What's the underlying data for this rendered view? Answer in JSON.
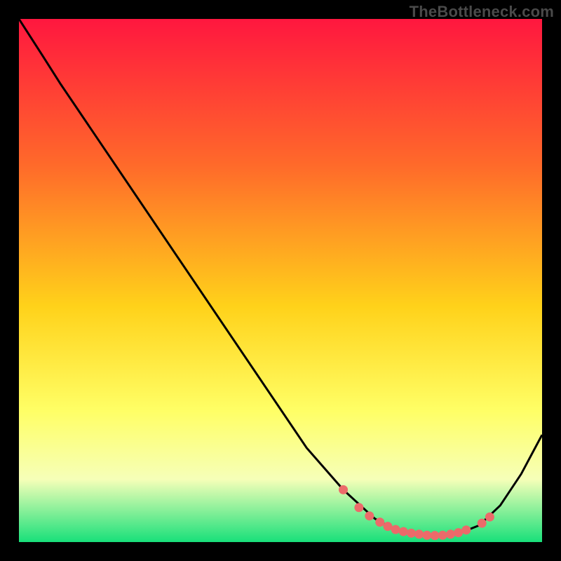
{
  "watermark": "TheBottleneck.com",
  "colors": {
    "grad_top": "#ff173f",
    "grad_mid1": "#ff6a2a",
    "grad_mid2": "#ffd21a",
    "grad_mid3": "#ffff66",
    "grad_mid4": "#f6ffb8",
    "grad_bottom": "#18e07a",
    "curve": "#000000",
    "markers": "#ec6a6a"
  },
  "chart_data": {
    "type": "line",
    "title": "",
    "xlabel": "",
    "ylabel": "",
    "xlim": [
      0,
      100
    ],
    "ylim": [
      0,
      100
    ],
    "gradient_stops": [
      {
        "offset": 0,
        "color": "#ff173f"
      },
      {
        "offset": 28,
        "color": "#ff6a2a"
      },
      {
        "offset": 55,
        "color": "#ffd21a"
      },
      {
        "offset": 75,
        "color": "#ffff66"
      },
      {
        "offset": 88,
        "color": "#f6ffb8"
      },
      {
        "offset": 100,
        "color": "#18e07a"
      }
    ],
    "curve_points": [
      {
        "x": 0.0,
        "y": 100.0
      },
      {
        "x": 4.5,
        "y": 93.0
      },
      {
        "x": 8.0,
        "y": 87.5
      },
      {
        "x": 55.0,
        "y": 18.0
      },
      {
        "x": 62.0,
        "y": 10.0
      },
      {
        "x": 68.0,
        "y": 4.5
      },
      {
        "x": 72.0,
        "y": 2.2
      },
      {
        "x": 76.0,
        "y": 1.4
      },
      {
        "x": 80.0,
        "y": 1.2
      },
      {
        "x": 84.0,
        "y": 1.6
      },
      {
        "x": 88.0,
        "y": 3.2
      },
      {
        "x": 92.0,
        "y": 7.0
      },
      {
        "x": 96.0,
        "y": 13.0
      },
      {
        "x": 100.0,
        "y": 20.5
      }
    ],
    "markers": [
      {
        "x": 62.0,
        "y": 10.0
      },
      {
        "x": 65.0,
        "y": 6.6
      },
      {
        "x": 67.0,
        "y": 5.0
      },
      {
        "x": 69.0,
        "y": 3.8
      },
      {
        "x": 70.5,
        "y": 3.0
      },
      {
        "x": 72.0,
        "y": 2.4
      },
      {
        "x": 73.5,
        "y": 2.0
      },
      {
        "x": 75.0,
        "y": 1.7
      },
      {
        "x": 76.5,
        "y": 1.5
      },
      {
        "x": 78.0,
        "y": 1.3
      },
      {
        "x": 79.5,
        "y": 1.25
      },
      {
        "x": 81.0,
        "y": 1.3
      },
      {
        "x": 82.5,
        "y": 1.5
      },
      {
        "x": 84.0,
        "y": 1.8
      },
      {
        "x": 85.5,
        "y": 2.3
      },
      {
        "x": 88.5,
        "y": 3.6
      },
      {
        "x": 90.0,
        "y": 4.8
      }
    ]
  }
}
